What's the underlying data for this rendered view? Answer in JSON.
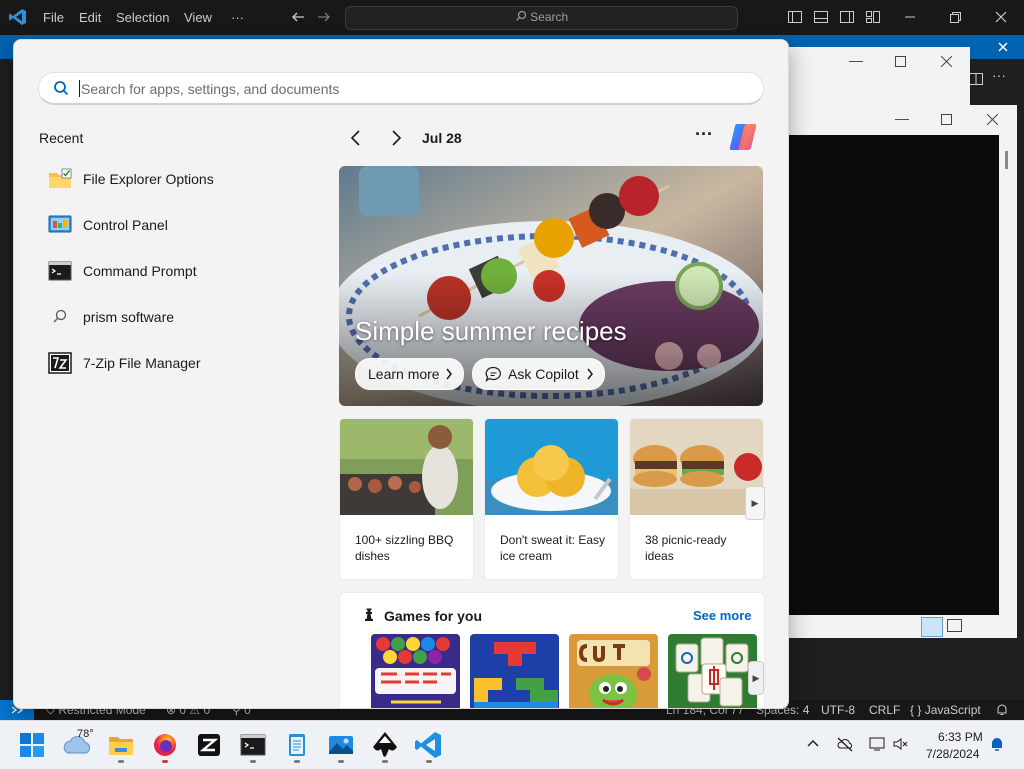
{
  "vscode": {
    "menu": [
      "File",
      "Edit",
      "Selection",
      "View",
      "···"
    ],
    "search_label": "Search",
    "status": {
      "restricted": "Restricted Mode",
      "problems": "0 ⚠ 0",
      "ports": "0",
      "position": "Ln 184, Col 77",
      "spaces": "Spaces: 4",
      "encoding": "UTF-8",
      "eol": "CRLF",
      "language": "JavaScript"
    }
  },
  "start_menu": {
    "search": {
      "placeholder": "Search for apps, settings, and documents"
    },
    "recent": {
      "title": "Recent",
      "items": [
        {
          "label": "File Explorer Options",
          "icon": "folder-options-icon"
        },
        {
          "label": "Control Panel",
          "icon": "control-panel-icon"
        },
        {
          "label": "Command Prompt",
          "icon": "command-prompt-icon"
        },
        {
          "label": "prism software",
          "icon": "search-icon"
        },
        {
          "label": "7-Zip File Manager",
          "icon": "7zip-icon"
        }
      ]
    },
    "feed": {
      "date": "Jul 28",
      "more": "···",
      "hero": {
        "title": "Simple summer recipes",
        "learn_more": "Learn more",
        "ask_copilot": "Ask Copilot"
      },
      "cards": [
        {
          "text": "100+ sizzling BBQ dishes"
        },
        {
          "text": "Don't sweat it: Easy ice cream"
        },
        {
          "text": "38 picnic-ready ideas"
        }
      ],
      "games": {
        "title": "Games for you",
        "see_more": "See more",
        "items": [
          "Bubble Shooter HD",
          "Block Puzzle",
          "Cut the Rope",
          "Mahjong"
        ]
      }
    }
  },
  "taskbar": {
    "weather_temp": "78°",
    "apps": [
      "start",
      "weather",
      "file-explorer",
      "firefox",
      "zed",
      "terminal",
      "notepad",
      "photos",
      "inkscape",
      "vscode"
    ],
    "clock": {
      "time": "6:33 PM",
      "date": "7/28/2024"
    }
  }
}
